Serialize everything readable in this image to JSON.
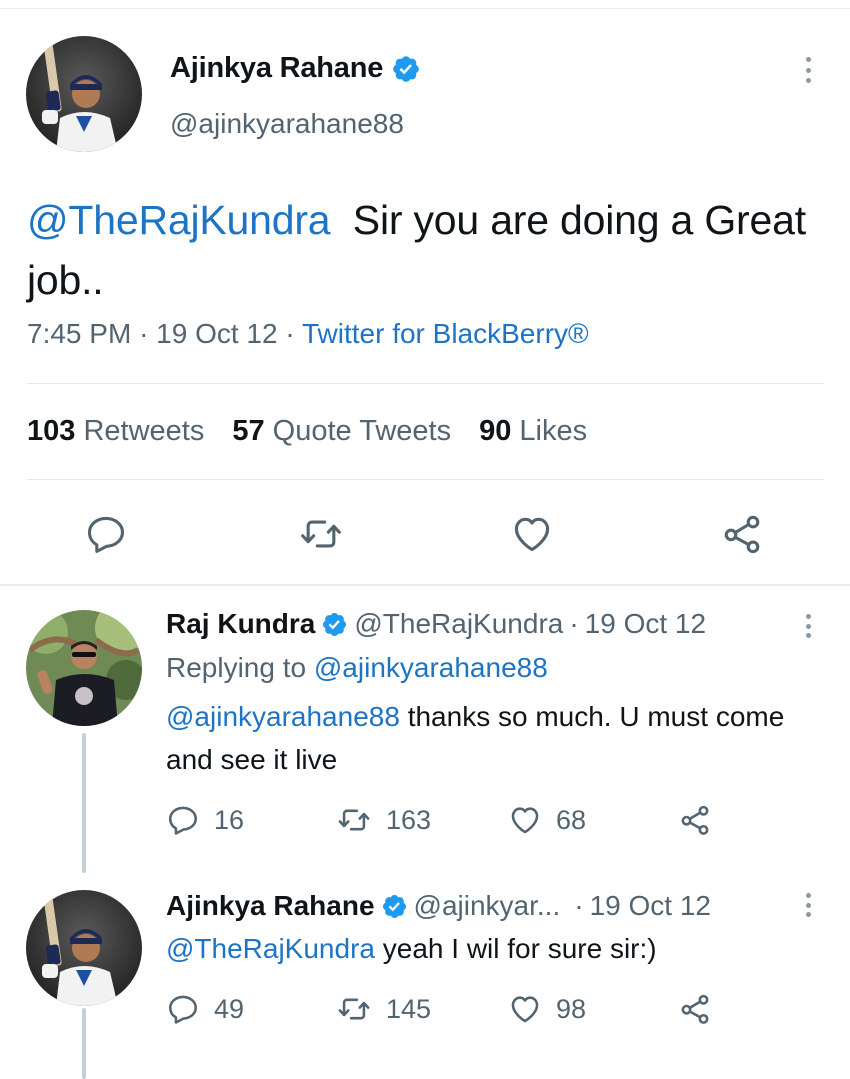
{
  "main_tweet": {
    "author_name": "Ajinkya Rahane",
    "author_handle": "@ajinkyarahane88",
    "mention": "@TheRajKundra",
    "text": "Sir you are doing a Great job..",
    "time": "7:45 PM",
    "date": "19 Oct 12",
    "source": "Twitter for BlackBerry®",
    "separator": "·",
    "retweets_count": "103",
    "retweets_label": "Retweets",
    "quote_count": "57",
    "quote_label": "Quote Tweets",
    "likes_count": "90",
    "likes_label": "Likes"
  },
  "replies": [
    {
      "author_name": "Raj Kundra",
      "author_handle": "@TheRajKundra",
      "date": "19 Oct 12",
      "replying_prefix": "Replying to",
      "replying_to": "@ajinkyarahane88",
      "mention": "@ajinkyarahane88",
      "text": "thanks so much. U must come and see it live",
      "replies_count": "16",
      "retweets_count": "163",
      "likes_count": "68"
    },
    {
      "author_name": "Ajinkya Rahane",
      "author_handle": "@ajinkyar...",
      "date": "19 Oct 12",
      "mention": "@TheRajKundra",
      "text": "yeah I wil for sure sir:)",
      "replies_count": "49",
      "retweets_count": "145",
      "likes_count": "98"
    }
  ],
  "icons": {
    "reply": "reply-bubble-icon",
    "retweet": "retweet-arrows-icon",
    "like": "heart-icon",
    "share": "share-nodes-icon",
    "verified": "verified-badge-icon",
    "more": "more-vertical-icon"
  },
  "colors": {
    "link": "#1d74c5",
    "verified": "#1d9bf0",
    "secondary_text": "#536471",
    "primary_text": "#0f1419"
  }
}
